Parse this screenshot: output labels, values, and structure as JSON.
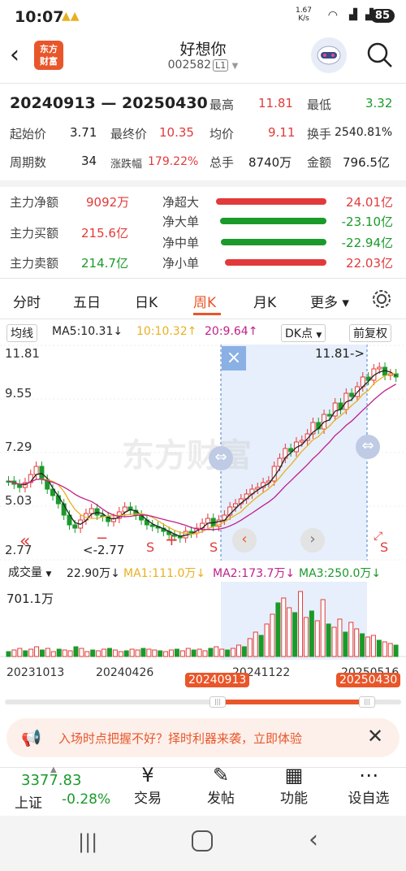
{
  "status_bar": {
    "time": "10:07",
    "net_speed": "1.67 K/s",
    "battery": "85"
  },
  "header": {
    "logo_text_1": "东方",
    "logo_text_2": "财富",
    "title": "好想你",
    "code": "002582",
    "code_tag": "L1"
  },
  "summary": {
    "range": "20240913 — 20250430",
    "row1": {
      "high_label": "最高",
      "high": "11.81",
      "low_label": "最低",
      "low": "3.32"
    },
    "row2": {
      "start_label": "起始价",
      "start": "3.71",
      "end_label": "最终价",
      "end": "10.35",
      "avg_label": "均价",
      "avg": "9.11",
      "turnover_label": "换手",
      "turnover": "2540.81%"
    },
    "row3": {
      "periods_label": "周期数",
      "periods": "34",
      "change_label": "涨跌幅",
      "change": "179.22%",
      "vol_label": "总手",
      "vol": "8740万",
      "amount_label": "金额",
      "amount": "796.5亿"
    }
  },
  "money": {
    "main_net_label": "主力净额",
    "main_net": "9092万",
    "main_buy_label": "主力买额",
    "main_buy": "215.6亿",
    "main_sell_label": "主力卖额",
    "main_sell": "214.7亿",
    "rows": [
      {
        "label": "净超大",
        "value": "24.01亿",
        "color": "#e23a3a",
        "ratio": 1.0
      },
      {
        "label": "净大单",
        "value": "-23.10亿",
        "color": "#1a9a2a",
        "ratio": 0.96
      },
      {
        "label": "净中单",
        "value": "-22.94亿",
        "color": "#1a9a2a",
        "ratio": 0.955
      },
      {
        "label": "净小单",
        "value": "22.03亿",
        "color": "#e23a3a",
        "ratio": 0.92
      }
    ]
  },
  "tabs": [
    "分时",
    "五日",
    "日K",
    "周K",
    "月K",
    "更多"
  ],
  "active_tab": "周K",
  "chart": {
    "indicator": "均线",
    "ma5": "MA5:10.31↓",
    "ma10": "10:10.32↑",
    "ma20": "20:9.64↑",
    "dk": "DK点",
    "adjust": "前复权",
    "y_labels": [
      "11.81",
      "9.55",
      "7.29",
      "5.03",
      "2.77"
    ],
    "high_marker": "11.81->",
    "low_marker": "<-2.77",
    "close_icon": "×",
    "vol_label": "成交量",
    "vol_val": "22.90万↓",
    "vol_ma1": "MA1:111.0万↓",
    "vol_ma2": "MA2:173.7万↓",
    "vol_ma3": "MA3:250.0万↓",
    "vol_max": "701.1万",
    "x_labels": [
      "20231013",
      "20240426",
      "20241122",
      "20250516"
    ],
    "sel_start": "20240913",
    "sel_end": "20250430",
    "s_mark": "S",
    "plus_mark": "+",
    "minus_mark": "−",
    "watermark": "东方财富"
  },
  "banner": {
    "text": "入场时点把握不好？择时利器来袭，立即体验"
  },
  "bottom": {
    "index_value": "3377.83",
    "index_name": "上证",
    "index_change": "-0.28%",
    "items": [
      "交易",
      "发帖",
      "功能",
      "设自选"
    ]
  },
  "colors": {
    "accent": "#e8562a",
    "up": "#e23a3a",
    "down": "#1a9a2a",
    "ma5": "#222222",
    "ma10": "#e8b020",
    "ma20": "#c0208a",
    "selection": "#e6effb"
  }
}
